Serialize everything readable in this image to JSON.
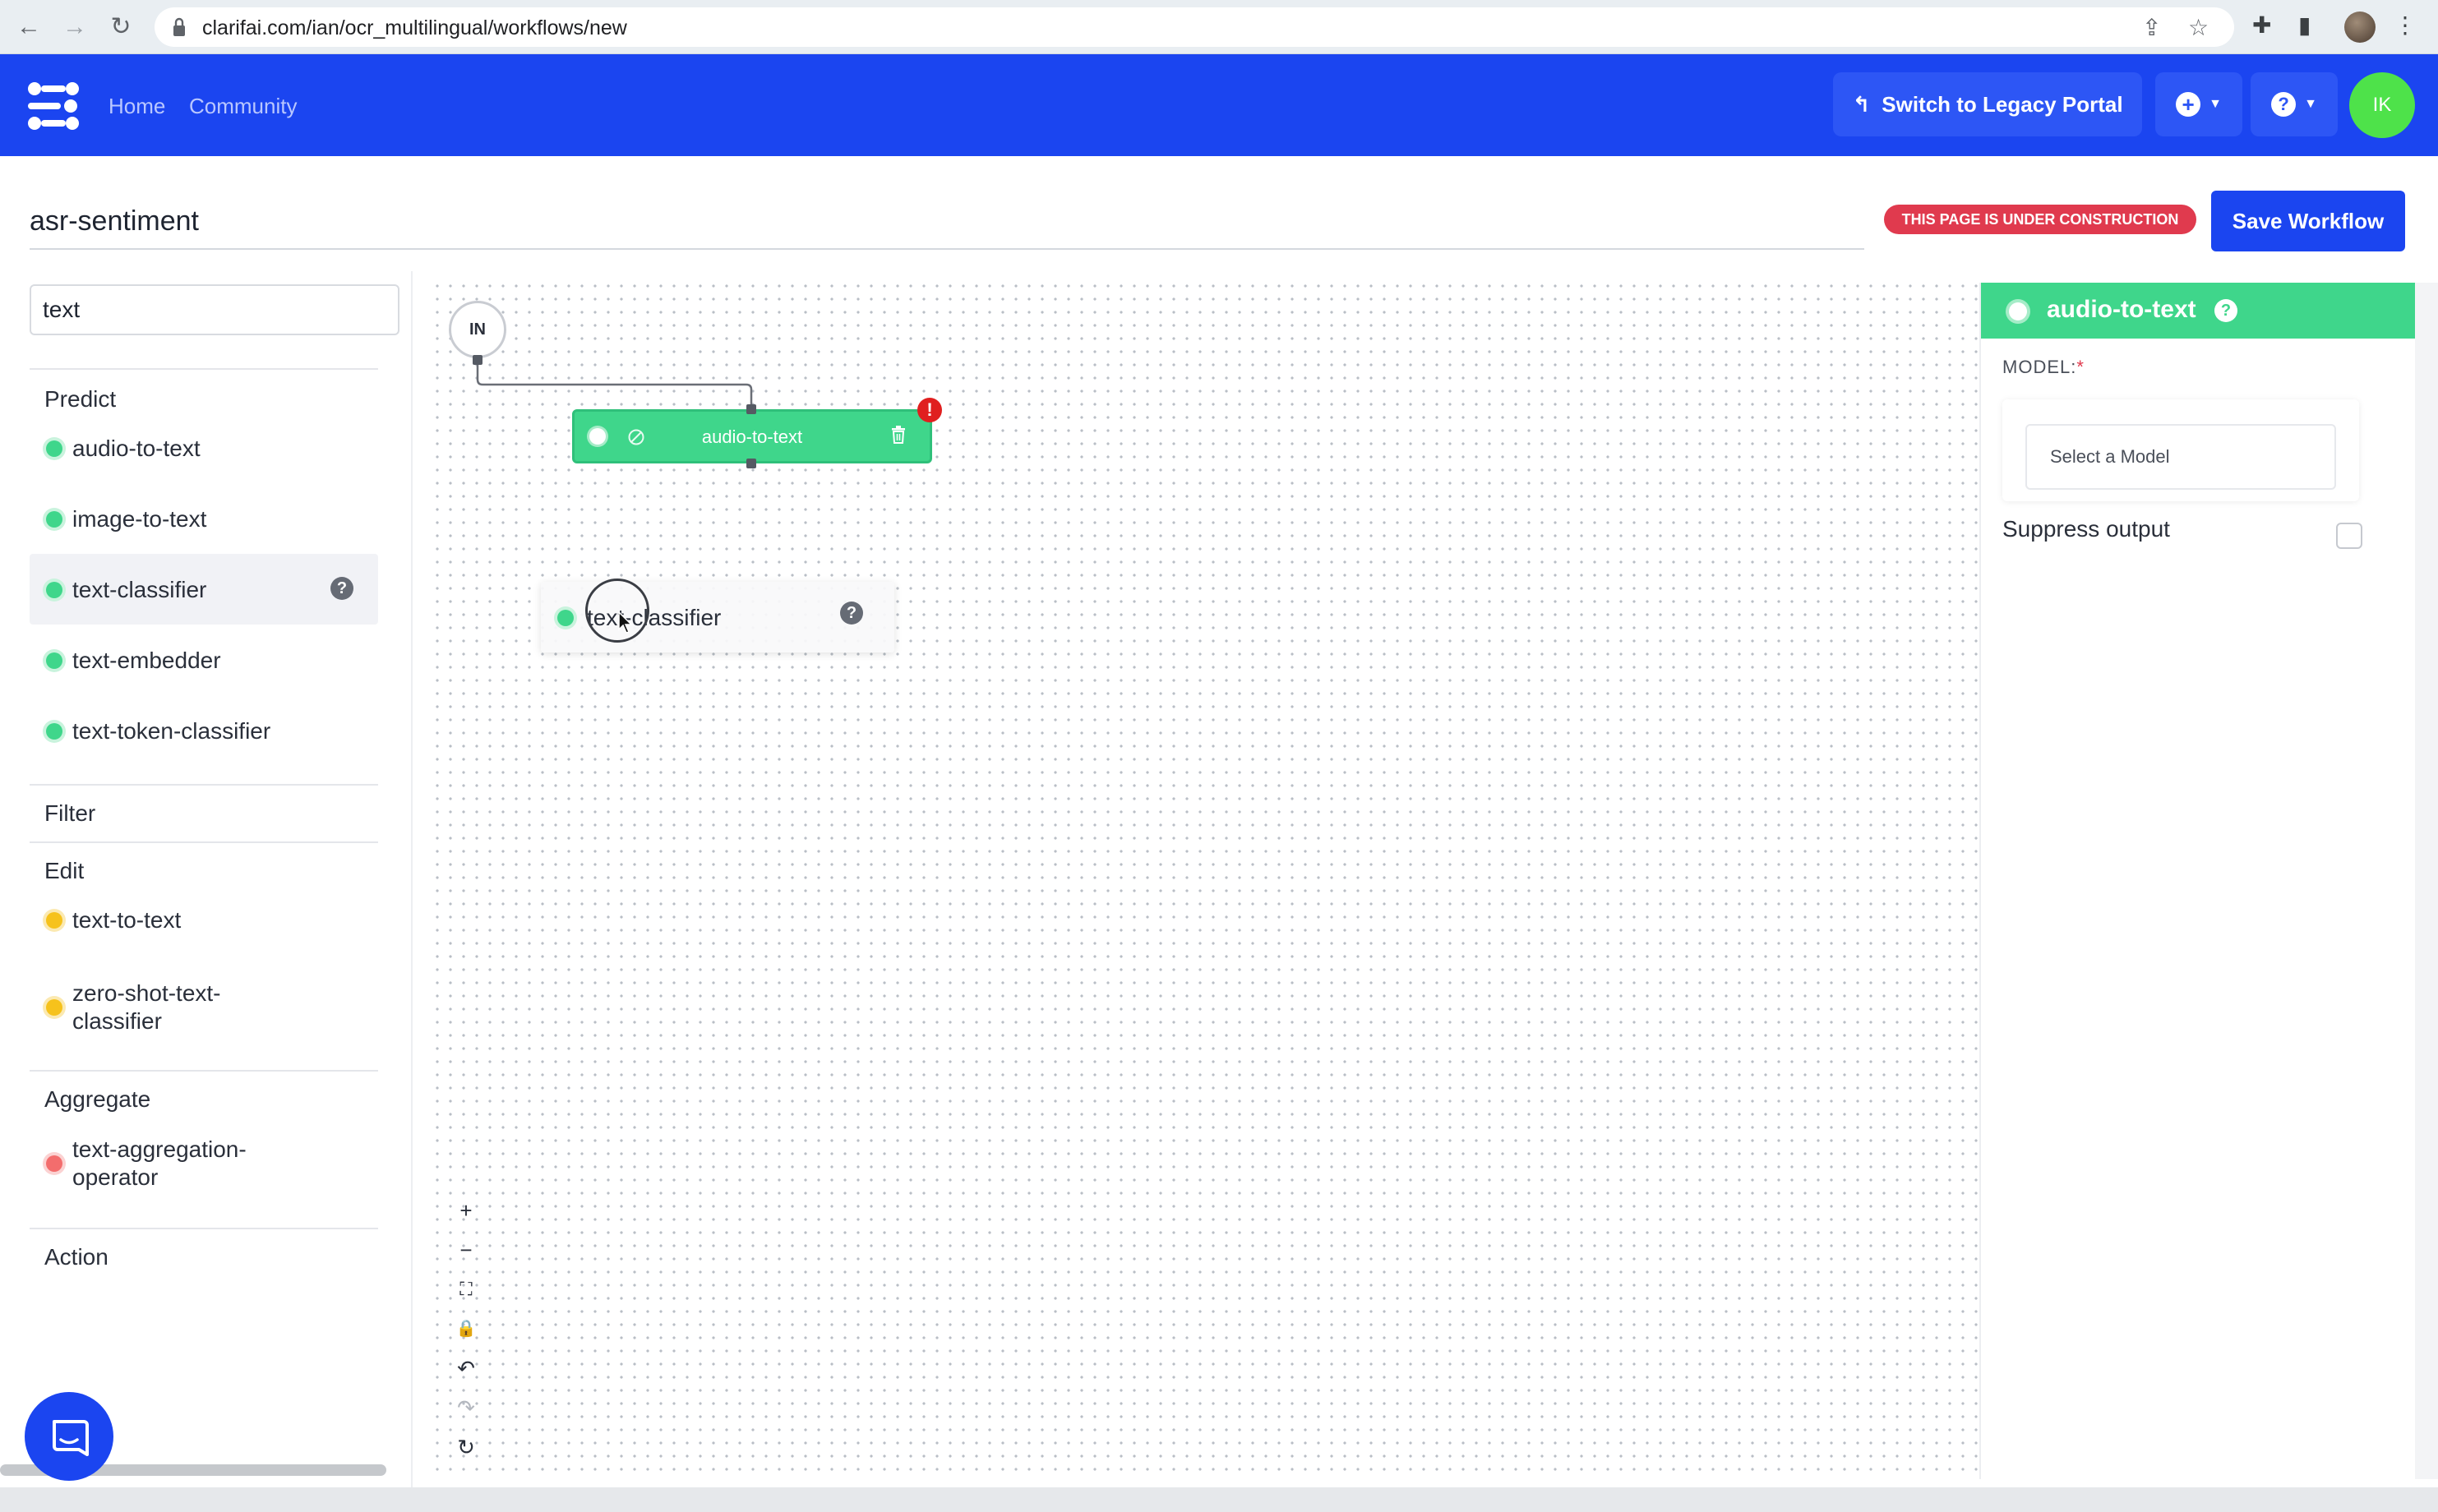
{
  "browser": {
    "url": "clarifai.com/ian/ocr_multilingual/workflows/new"
  },
  "header": {
    "nav": [
      "Home",
      "Community"
    ],
    "legacy_button": "Switch to Legacy Portal",
    "avatar_initials": "IK"
  },
  "workflow": {
    "title": "asr-sentiment",
    "construction_badge": "THIS PAGE IS UNDER CONSTRUCTION",
    "save_label": "Save Workflow"
  },
  "sidebar": {
    "search_value": "text",
    "categories": {
      "predict": "Predict",
      "filter": "Filter",
      "edit": "Edit",
      "aggregate": "Aggregate",
      "action": "Action"
    },
    "predict_items": [
      "audio-to-text",
      "image-to-text",
      "text-classifier",
      "text-embedder",
      "text-token-classifier"
    ],
    "edit_items": [
      "text-to-text",
      "zero-shot-text-classifier"
    ],
    "edit_item_lines": [
      [
        "text-to-text"
      ],
      [
        "zero-shot-text-",
        "classifier"
      ]
    ],
    "aggregate_item_lines": [
      [
        "text-aggregation-",
        "operator"
      ]
    ],
    "help_glyph": "?"
  },
  "canvas": {
    "input_node": "IN",
    "node_label": "audio-to-text",
    "error_glyph": "!",
    "drag_label": "text-classifier",
    "controls": [
      "+",
      "−",
      "⛶",
      "🔒",
      "↶",
      "↷",
      "↻"
    ]
  },
  "panel": {
    "title": "audio-to-text",
    "model_label": "MODEL:",
    "required_mark": "*",
    "select_placeholder": "Select a Model",
    "suppress_label": "Suppress output",
    "suppress_checked": false
  },
  "colors": {
    "brand_blue": "#1b45f0",
    "predict_green": "#3fd68b",
    "edit_yellow": "#f6c21c",
    "aggregate_red": "#f36d6d",
    "danger": "#e03a4e"
  }
}
